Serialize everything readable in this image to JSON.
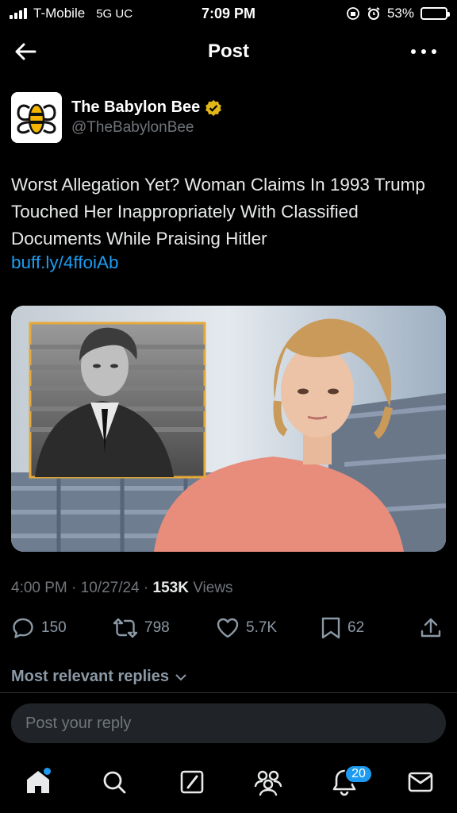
{
  "status_bar": {
    "carrier": "T-Mobile",
    "network": "5G UC",
    "time": "7:09 PM",
    "battery_percent": "53%",
    "battery_level": 0.53
  },
  "header": {
    "title": "Post"
  },
  "author": {
    "name": "The Babylon Bee",
    "handle": "@TheBabylonBee",
    "verified": true
  },
  "tweet": {
    "text": "Worst Allegation Yet? Woman Claims In 1993 Trump Touched Her Inappropriately With Classified Documents While Praising Hitler",
    "link": "buff.ly/4ffoiAb"
  },
  "meta": {
    "time": "4:00 PM",
    "date": "10/27/24",
    "views_count": "153K",
    "views_label": "Views"
  },
  "actions": {
    "replies": "150",
    "reposts": "798",
    "likes": "5.7K",
    "bookmarks": "62"
  },
  "replies_filter": {
    "label": "Most relevant replies"
  },
  "reply_box": {
    "placeholder": "Post your reply"
  },
  "bottom_nav": {
    "notifications_badge": "20"
  },
  "colors": {
    "accent": "#1d9bf0",
    "verified_gold": "#e2b719",
    "background": "#000000",
    "secondary_text": "#71767b"
  },
  "icons": [
    "signal-icon",
    "alarm-icon",
    "battery-icon",
    "back-arrow-icon",
    "more-icon",
    "verified-badge-icon",
    "reply-icon",
    "repost-icon",
    "like-icon",
    "bookmark-icon",
    "share-icon",
    "chevron-down-icon",
    "home-icon",
    "search-icon",
    "compose-icon",
    "communities-icon",
    "notifications-icon",
    "messages-icon"
  ]
}
